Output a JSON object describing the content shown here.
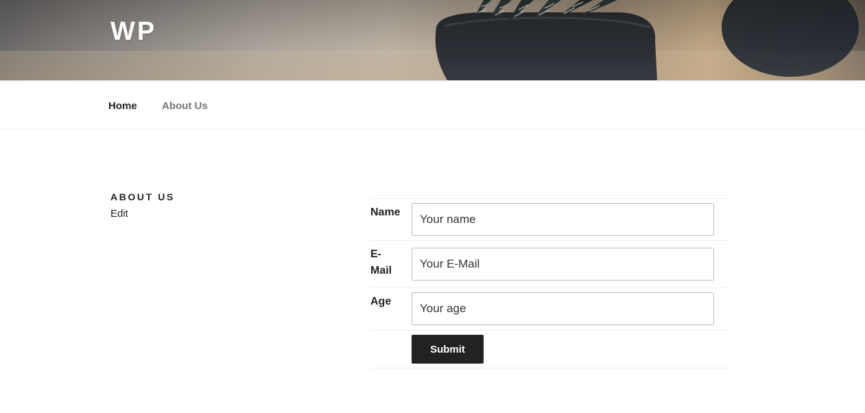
{
  "site": {
    "title": "WP"
  },
  "nav": {
    "items": [
      {
        "label": "Home"
      },
      {
        "label": "About Us"
      }
    ]
  },
  "page": {
    "heading": "ABOUT US",
    "edit_label": "Edit"
  },
  "form": {
    "fields": [
      {
        "label": "Name",
        "placeholder": "Your name",
        "value": ""
      },
      {
        "label": "E-Mail",
        "placeholder": "Your E-Mail",
        "value": ""
      },
      {
        "label": "Age",
        "placeholder": "Your age",
        "value": ""
      }
    ],
    "submit_label": "Submit"
  },
  "colors": {
    "text": "#222222",
    "nav_inactive": "#767676",
    "button_bg": "#222222",
    "button_text": "#ffffff"
  }
}
